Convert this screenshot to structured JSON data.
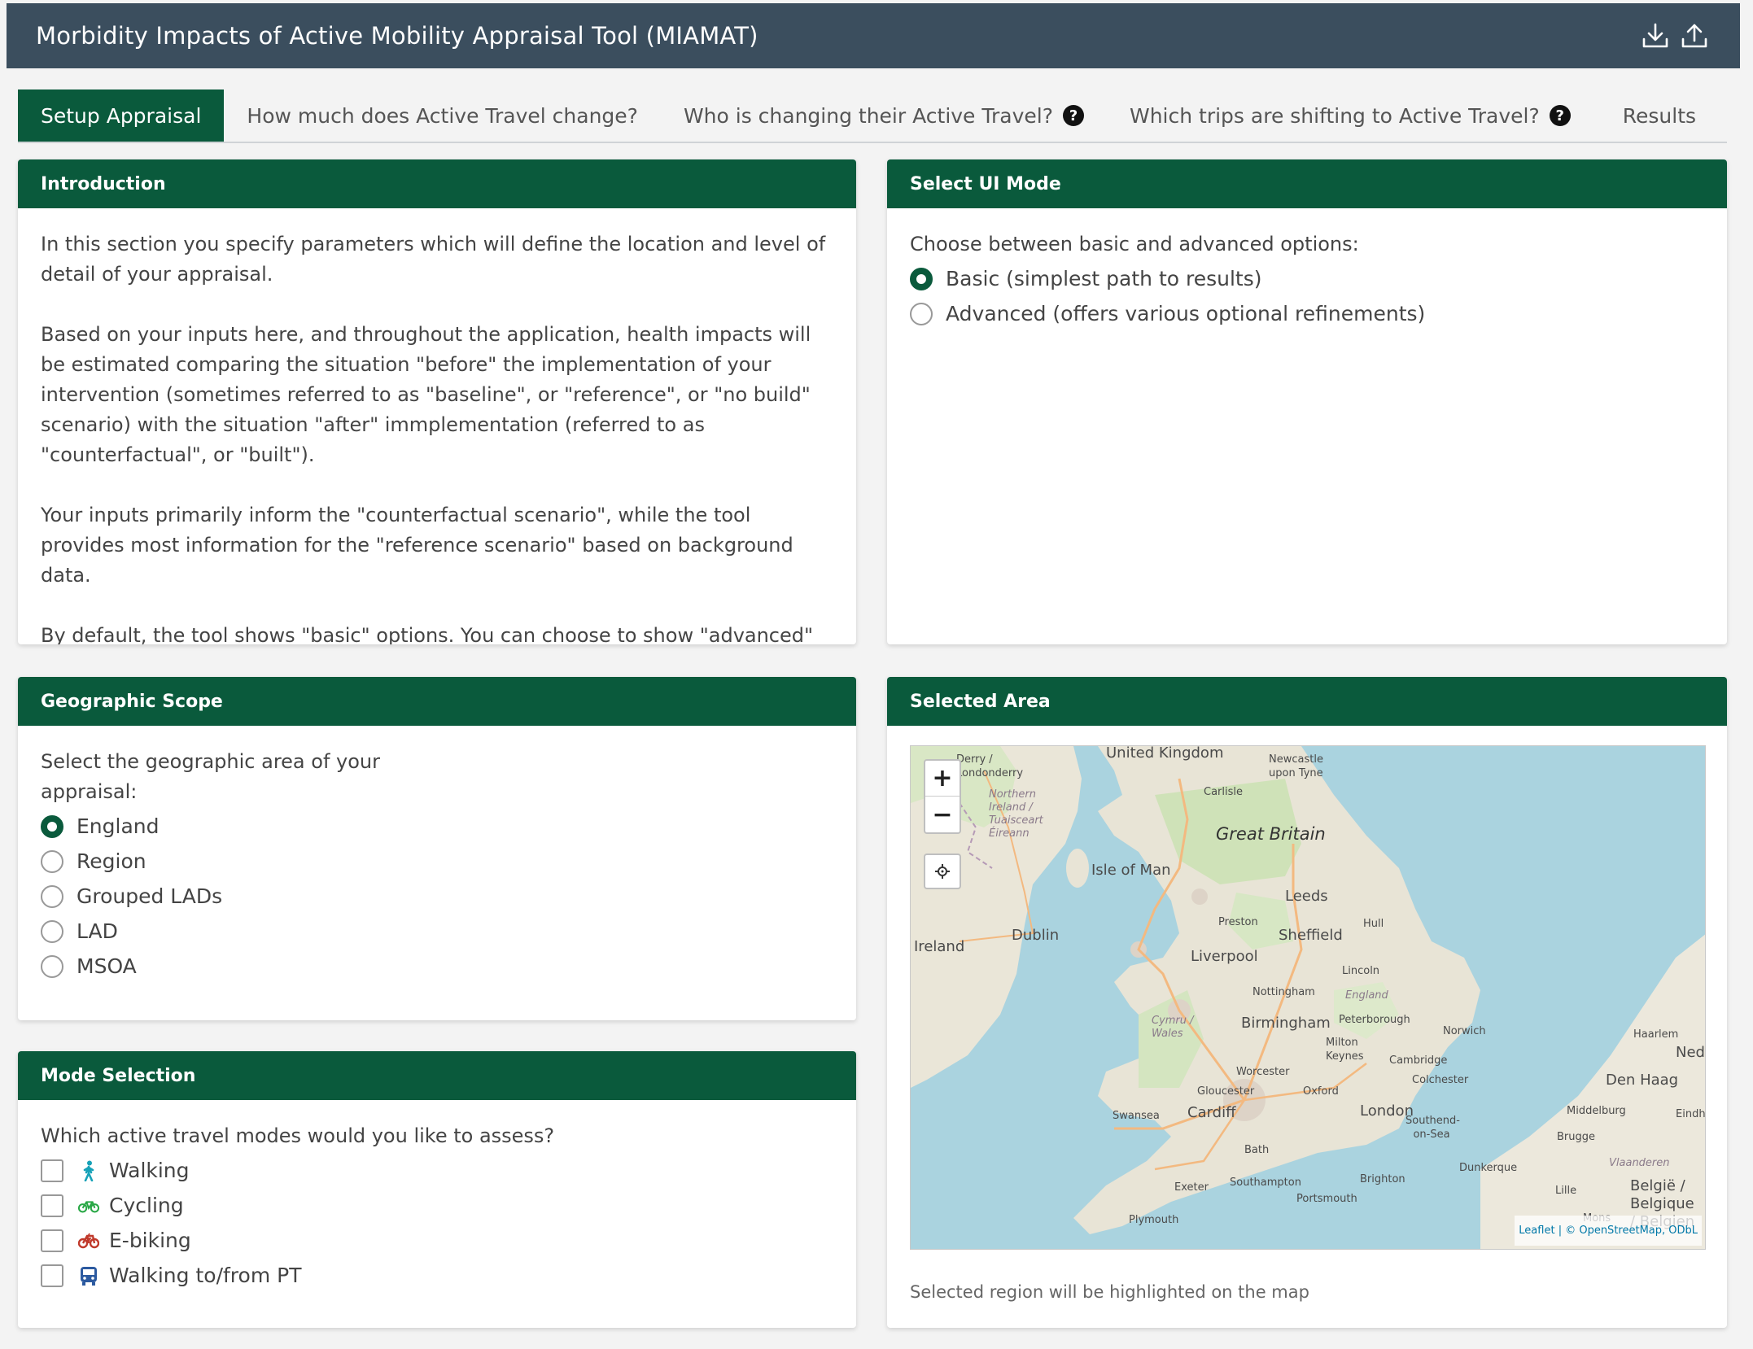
{
  "header": {
    "title": "Morbidity Impacts of Active Mobility Appraisal Tool (MIAMAT)",
    "download_icon": "download-icon",
    "upload_icon": "upload-icon",
    "bg_color": "#3b4e5e"
  },
  "tabs": [
    {
      "label": "Setup Appraisal",
      "active": true
    },
    {
      "label": "How much does Active Travel change?",
      "active": false
    },
    {
      "label": "Who is changing their Active Travel?",
      "active": false,
      "help": true
    },
    {
      "label": "Which trips are shifting to Active Travel?",
      "active": false,
      "help": true
    },
    {
      "label": "Results",
      "active": false
    }
  ],
  "help_glyph": "?",
  "accent_color": "#0a5a3c",
  "introduction": {
    "title": "Introduction",
    "paragraphs": [
      "In this section you specify parameters which will define the location and level of detail of your appraisal.",
      "Based on your inputs here, and throughout the application, health impacts will be estimated comparing the situation \"before\" the implementation of your intervention (sometimes referred to as \"baseline\", or \"reference\", or \"no build\" scenario) with the situation \"after\" immplementation (referred to as \"counterfactual\", or \"built\").",
      "Your inputs primarily inform the \"counterfactual scenario\", while the tool provides most information for the \"reference scenario\" based on background data.",
      "By default, the tool shows \"basic\" options. You can choose to show \"advanced\" options in the panel to the right."
    ]
  },
  "ui_mode": {
    "title": "Select UI Mode",
    "prompt": "Choose between basic and advanced options:",
    "options": [
      {
        "label": "Basic (simplest path to results)",
        "selected": true
      },
      {
        "label": "Advanced (offers various optional refinements)",
        "selected": false
      }
    ]
  },
  "geographic_scope": {
    "title": "Geographic Scope",
    "prompt": "Select the geographic area of your appraisal:",
    "options": [
      {
        "label": "England",
        "selected": true
      },
      {
        "label": "Region",
        "selected": false
      },
      {
        "label": "Grouped LADs",
        "selected": false
      },
      {
        "label": "LAD",
        "selected": false
      },
      {
        "label": "MSOA",
        "selected": false
      }
    ]
  },
  "mode_selection": {
    "title": "Mode Selection",
    "prompt": "Which active travel modes would you like to assess?",
    "modes": [
      {
        "label": "Walking",
        "icon": "walking-icon",
        "color": "#17a2b8",
        "checked": false
      },
      {
        "label": "Cycling",
        "icon": "bicycle-icon",
        "color": "#28a745",
        "checked": false
      },
      {
        "label": "E-biking",
        "icon": "ebike-icon",
        "color": "#c0392b",
        "checked": false
      },
      {
        "label": "Walking to/from PT",
        "icon": "bus-icon",
        "color": "#2c5aa0",
        "checked": false
      }
    ]
  },
  "selected_area": {
    "title": "Selected Area",
    "zoom_in": "+",
    "zoom_out": "−",
    "attribution_leaflet": "Leaflet",
    "attribution_rest": " | © OpenStreetMap, ODbL",
    "note": "Selected region will be highlighted on the map",
    "places": [
      {
        "name": "United Kingdom",
        "cls": "mid"
      },
      {
        "name": "Derry / Londonderry",
        "cls": "small"
      },
      {
        "name": "Northern Ireland / Tuaisceart Éireann",
        "cls": "small"
      },
      {
        "name": "Newcastle upon Tyne",
        "cls": "small"
      },
      {
        "name": "Carlisle",
        "cls": "small"
      },
      {
        "name": "Great Britain",
        "cls": "big"
      },
      {
        "name": "Isle of Man",
        "cls": "mid"
      },
      {
        "name": "Leeds",
        "cls": "mid"
      },
      {
        "name": "Preston",
        "cls": "small"
      },
      {
        "name": "Hull",
        "cls": "small"
      },
      {
        "name": "Sheffield",
        "cls": "mid"
      },
      {
        "name": "Ireland",
        "cls": "mid"
      },
      {
        "name": "Dublin",
        "cls": "mid"
      },
      {
        "name": "Liverpool",
        "cls": "mid"
      },
      {
        "name": "Lincoln",
        "cls": "small"
      },
      {
        "name": "Nottingham",
        "cls": "small"
      },
      {
        "name": "England",
        "cls": "small"
      },
      {
        "name": "Birmingham",
        "cls": "mid"
      },
      {
        "name": "Peterborough",
        "cls": "small"
      },
      {
        "name": "Norwich",
        "cls": "small"
      },
      {
        "name": "Cymru / Wales",
        "cls": "small"
      },
      {
        "name": "Milton Keynes",
        "cls": "small"
      },
      {
        "name": "Worcester",
        "cls": "small"
      },
      {
        "name": "Cambridge",
        "cls": "small"
      },
      {
        "name": "Colchester",
        "cls": "small"
      },
      {
        "name": "Gloucester",
        "cls": "small"
      },
      {
        "name": "Oxford",
        "cls": "small"
      },
      {
        "name": "Swansea",
        "cls": "small"
      },
      {
        "name": "Cardiff",
        "cls": "mid"
      },
      {
        "name": "London",
        "cls": "mid"
      },
      {
        "name": "Southend-on-Sea",
        "cls": "small"
      },
      {
        "name": "Bath",
        "cls": "small"
      },
      {
        "name": "Exeter",
        "cls": "small"
      },
      {
        "name": "Southampton",
        "cls": "small"
      },
      {
        "name": "Brighton",
        "cls": "small"
      },
      {
        "name": "Portsmouth",
        "cls": "small"
      },
      {
        "name": "Plymouth",
        "cls": "small"
      },
      {
        "name": "Dunkerque",
        "cls": "small"
      },
      {
        "name": "Haarlem",
        "cls": "small"
      },
      {
        "name": "Ned",
        "cls": "mid"
      },
      {
        "name": "Den Haag",
        "cls": "mid"
      },
      {
        "name": "Middelburg",
        "cls": "small"
      },
      {
        "name": "Eindh",
        "cls": "small"
      },
      {
        "name": "Brugge",
        "cls": "small"
      },
      {
        "name": "Lille",
        "cls": "small"
      },
      {
        "name": "Mons",
        "cls": "small"
      },
      {
        "name": "België / Belgique / Belgien",
        "cls": "mid"
      },
      {
        "name": "Vlaanderen",
        "cls": "small"
      }
    ]
  }
}
